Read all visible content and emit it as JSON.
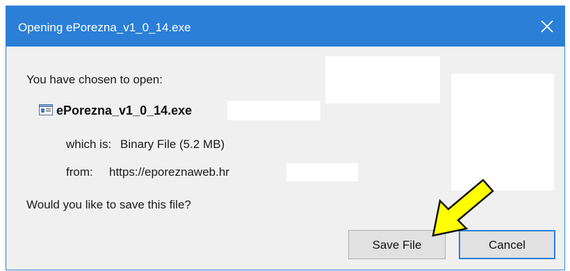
{
  "dialog": {
    "title": "Opening ePorezna_v1_0_14.exe",
    "prompt": "You have chosen to open:",
    "file_name": "ePorezna_v1_0_14.exe",
    "which_is_label": "which is:",
    "which_is_value": "Binary File (5.2 MB)",
    "from_label": "from:",
    "from_value": "https://eporeznaweb.hr",
    "question": "Would you like to save this file?",
    "save_label": "Save File",
    "cancel_label": "Cancel"
  },
  "icons": {
    "close": "close-icon",
    "file": "file-icon",
    "annotation": "arrow-annotation-icon"
  },
  "colors": {
    "titlebar": "#2b7fd7",
    "dialog_bg": "#f0f0f0",
    "arrow_fill": "#ffff00"
  }
}
